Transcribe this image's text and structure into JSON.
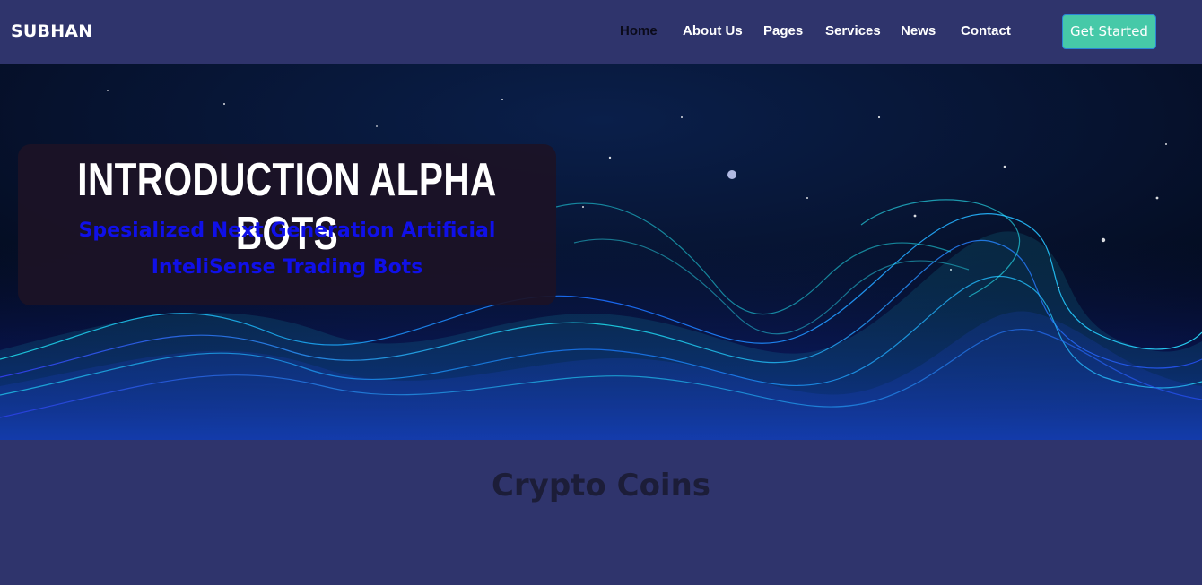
{
  "header": {
    "brand": "SUBHAN",
    "nav": [
      "Home",
      "About Us",
      "Pages",
      "Services",
      "News",
      "Contact"
    ],
    "active": "Home",
    "cta_label": "Get Started"
  },
  "hero": {
    "background": "starry space with glowing cyan/blue wave mesh",
    "title": "INTRODUCTION ALPHA BOTS",
    "subtitle": "Spesialized Next Generation Artificial InteliSense Trading Bots"
  },
  "section": {
    "title": "Crypto Coins"
  },
  "colors": {
    "background": "#2f346c",
    "cta": "#46c9a8",
    "subtitle": "#1010e8",
    "active_nav": "#0b0b1a"
  }
}
